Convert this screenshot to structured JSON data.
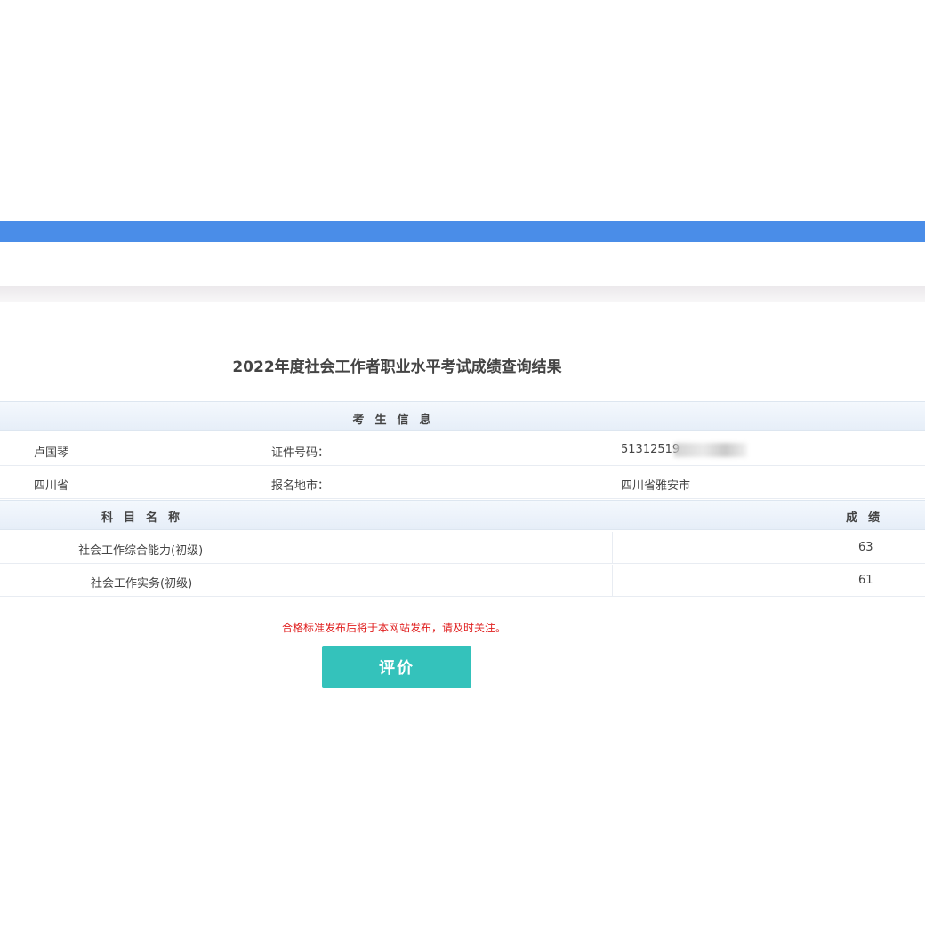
{
  "page": {
    "title": "2022年度社会工作者职业水平考试成绩查询结果",
    "notice": "合格标准发布后将于本网站发布，请及时关注。"
  },
  "candidate": {
    "section_title": "考生信息",
    "name": "卢国琴",
    "id_label": "证件号码：",
    "id_value": "51312519",
    "province": "四川省",
    "city_label": "报名地市：",
    "city_value": "四川省雅安市"
  },
  "scores": {
    "subject_header": "科目名称",
    "score_header": "成绩",
    "rows": [
      {
        "subject": "社会工作综合能力(初级)",
        "score": "63"
      },
      {
        "subject": "社会工作实务(初级)",
        "score": "61"
      }
    ]
  },
  "actions": {
    "evaluate_label": "评价"
  },
  "colors": {
    "top_bar": "#4a8de8",
    "button": "#34c2bb",
    "notice": "#e02020"
  }
}
